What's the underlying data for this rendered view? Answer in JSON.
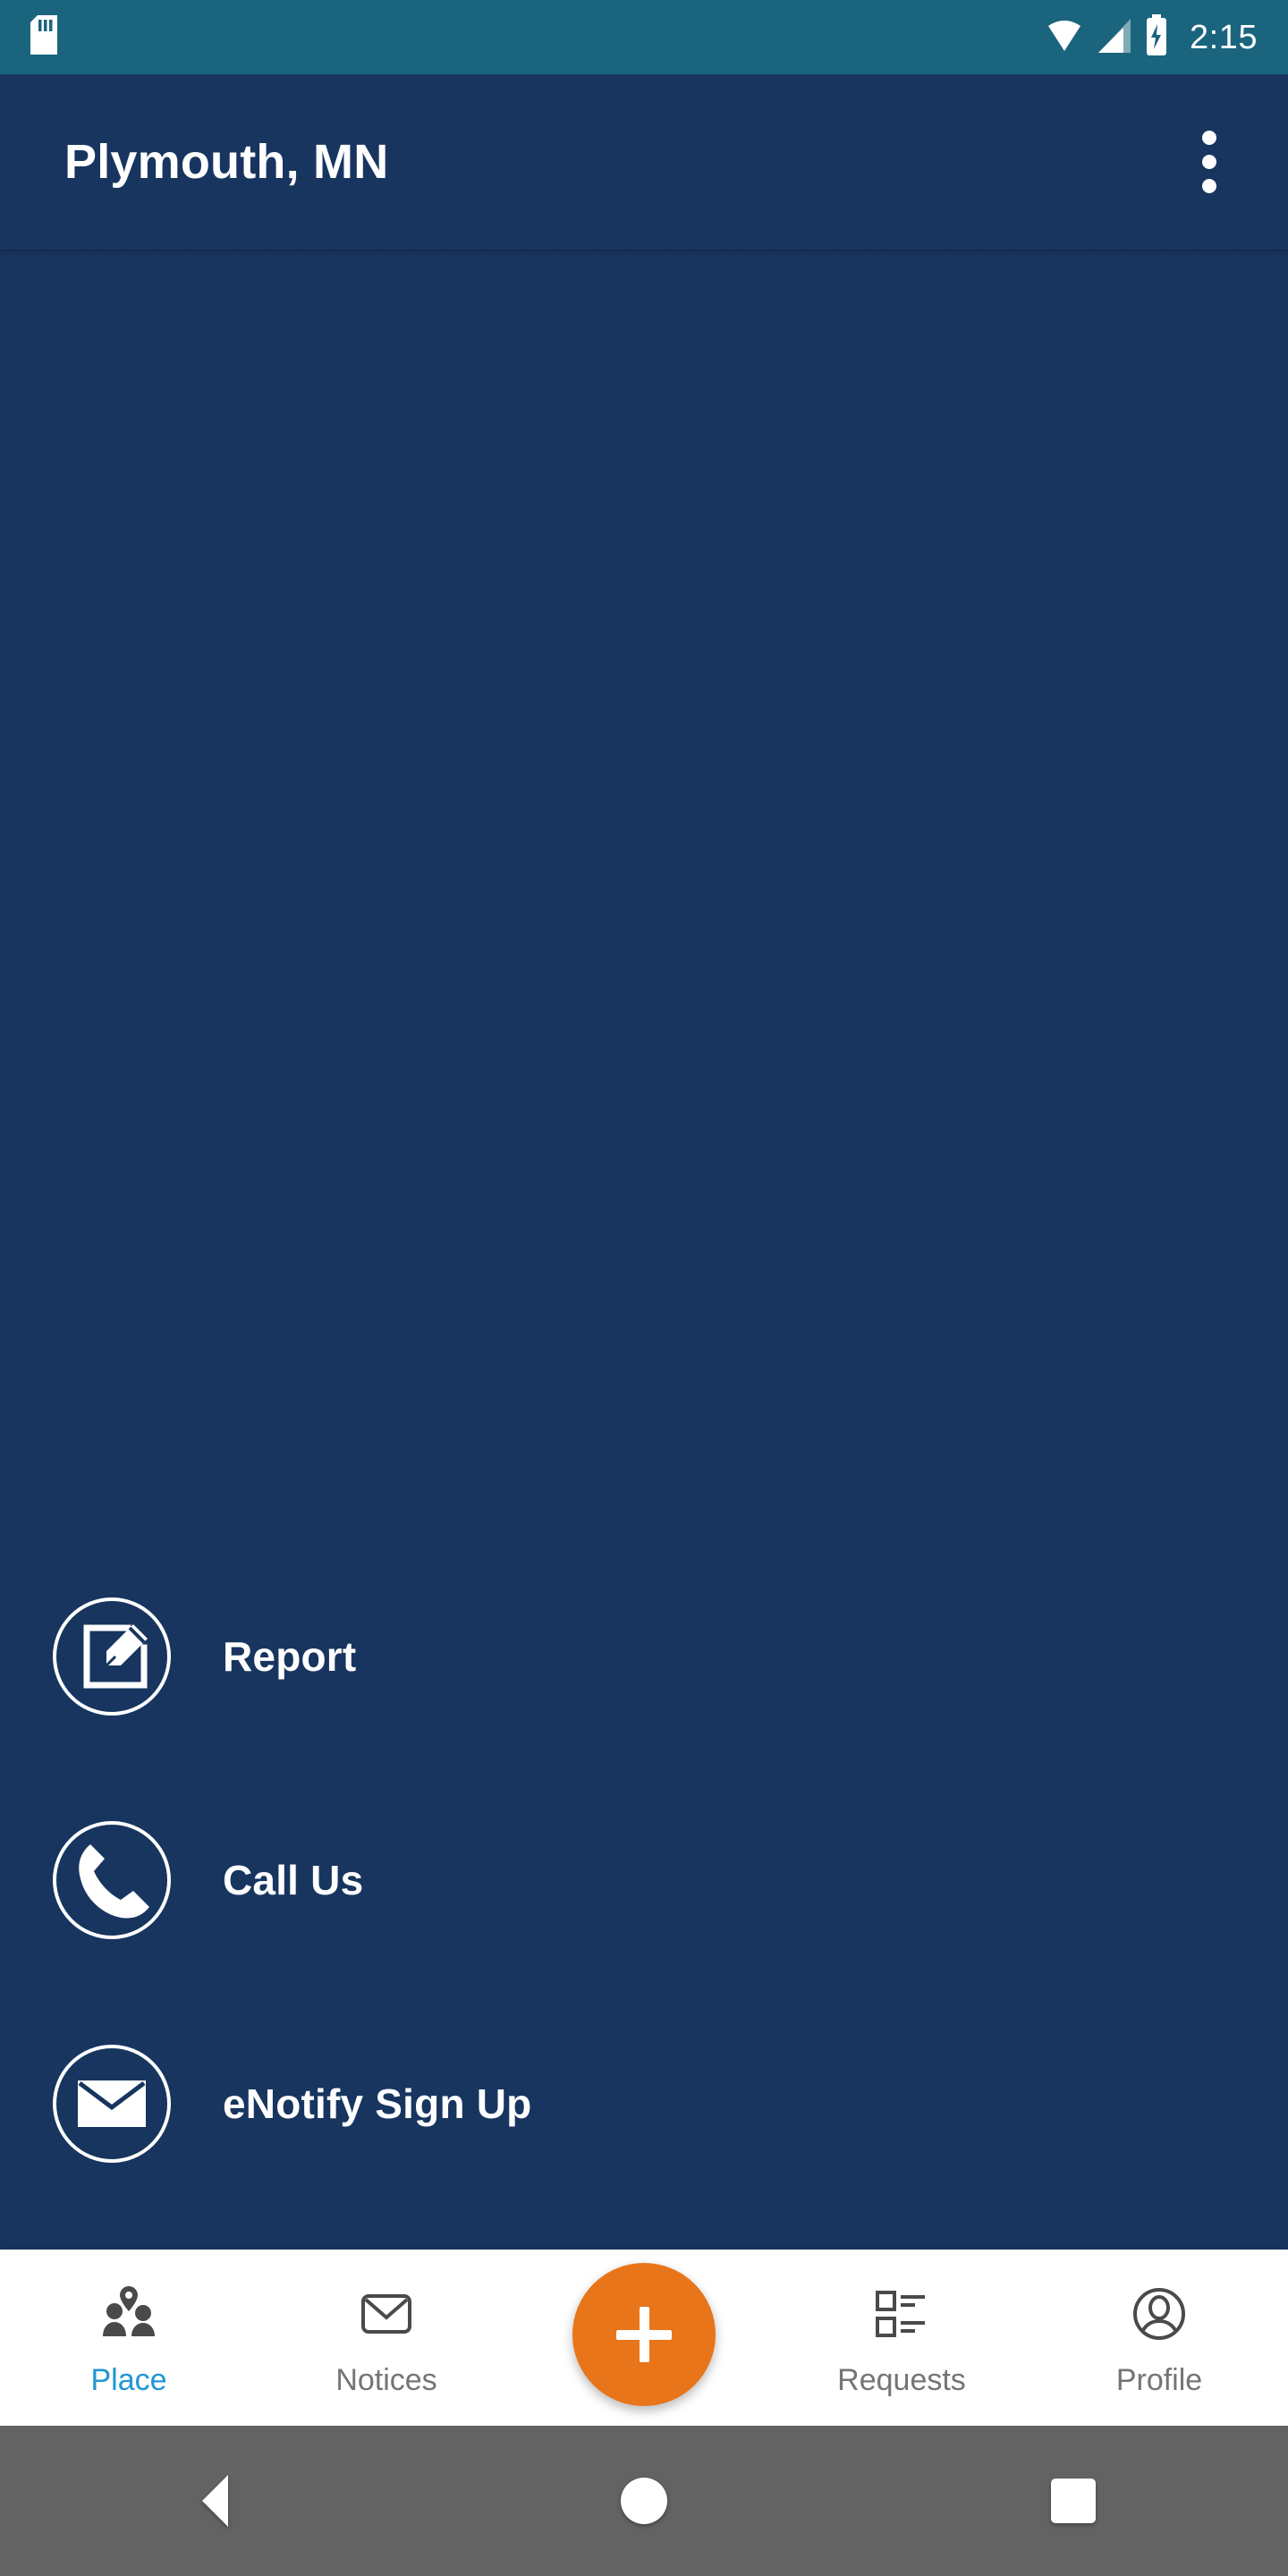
{
  "status_bar": {
    "time": "2:15",
    "background_color": "#1a647e",
    "icons": [
      "sd-card-icon",
      "wifi-icon",
      "cellular-signal-icon",
      "battery-charging-icon"
    ]
  },
  "app_bar": {
    "title": "Plymouth, MN",
    "background_color": "#17355f",
    "overflow_menu": "more-options"
  },
  "content": {
    "background_color": "#17355f",
    "actions": [
      {
        "label": "Report",
        "icon": "edit-square-icon"
      },
      {
        "label": "Call Us",
        "icon": "phone-icon"
      },
      {
        "label": "eNotify Sign Up",
        "icon": "envelope-icon"
      }
    ]
  },
  "bottom_nav": {
    "active_color": "#2196d4",
    "inactive_color": "#757575",
    "items": [
      {
        "label": "Place",
        "icon": "people-place-icon",
        "active": true
      },
      {
        "label": "Notices",
        "icon": "envelope-outline-icon",
        "active": false
      },
      {
        "label": "Requests",
        "icon": "list-checkboxes-icon",
        "active": false
      },
      {
        "label": "Profile",
        "icon": "account-circle-icon",
        "active": false
      }
    ],
    "fab": {
      "icon": "plus-icon",
      "color": "#e8751a"
    }
  },
  "android_nav": {
    "background_color": "#636363",
    "buttons": [
      {
        "name": "back",
        "icon": "triangle-back-icon"
      },
      {
        "name": "home",
        "icon": "circle-home-icon"
      },
      {
        "name": "recents",
        "icon": "square-recents-icon"
      }
    ]
  }
}
